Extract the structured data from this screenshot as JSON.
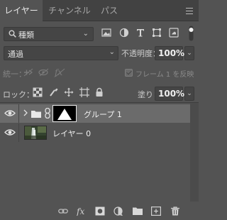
{
  "tabs": [
    {
      "label": "レイヤー",
      "active": true
    },
    {
      "label": "チャンネル",
      "active": false
    },
    {
      "label": "パス",
      "active": false
    }
  ],
  "filter": {
    "kind_label": "種類"
  },
  "blend": {
    "mode": "通過",
    "opacity_label": "不透明度：",
    "opacity_value": "100%"
  },
  "unify": {
    "label": "統一：",
    "propagate_label": "フレーム 1 を反映"
  },
  "lock": {
    "label": "ロック：",
    "fill_label": "塗り：",
    "fill_value": "100%"
  },
  "layers": [
    {
      "name": "グループ 1",
      "type": "group",
      "visible": true,
      "selected": true
    },
    {
      "name": "レイヤー 0",
      "type": "image",
      "visible": true,
      "selected": false
    }
  ],
  "bottom_icons": [
    "link-layers-icon",
    "fx-icon",
    "add-mask-icon",
    "adjustment-layer-icon",
    "new-group-icon",
    "new-layer-icon",
    "delete-icon"
  ],
  "colors": {
    "panel": "#535353",
    "selected_row": "#6b6b6b",
    "tab_bar": "#424242"
  }
}
